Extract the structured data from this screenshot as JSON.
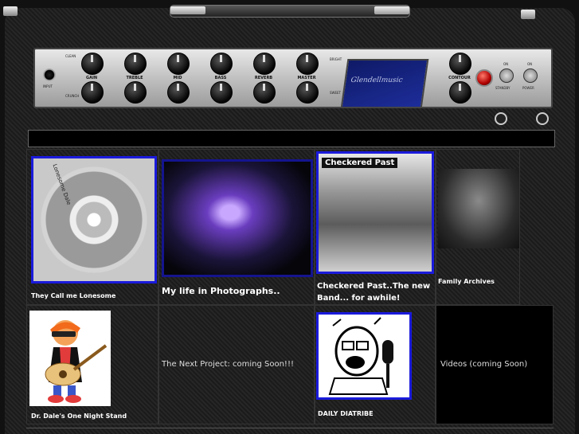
{
  "amp": {
    "input_label": "INPUT",
    "switch_top_label": "CLEAN",
    "switch_bottom_label": "CRUNCH",
    "bright_label": "BRIGHT",
    "sweet_label": "SWEET",
    "knobs": [
      {
        "label": "GAIN"
      },
      {
        "label": "TREBLE"
      },
      {
        "label": "MID"
      },
      {
        "label": "BASS"
      },
      {
        "label": "REVERB"
      },
      {
        "label": "MASTER"
      }
    ],
    "logo_text": "Glendellmusic",
    "contour_label": "CONTOUR",
    "standby_on": "ON",
    "standby_label": "STANDBY",
    "power_on": "ON",
    "power_label": "POWER"
  },
  "tiles": [
    {
      "caption": "They Call me Lonesome",
      "cd_text": "Lonesome Dale"
    },
    {
      "caption": "My life in Photographs.."
    },
    {
      "caption": "Checkered Past..The new Band...  for awhile!",
      "image_title": "Checkered Past"
    },
    {
      "caption": "Family Archives"
    },
    {
      "caption": "Dr. Dale's One Night Stand"
    },
    {
      "caption": "The Next Project: coming Soon!!!"
    },
    {
      "caption": "DAILY DIATRIBE"
    },
    {
      "caption": "Videos (coming Soon)"
    }
  ]
}
